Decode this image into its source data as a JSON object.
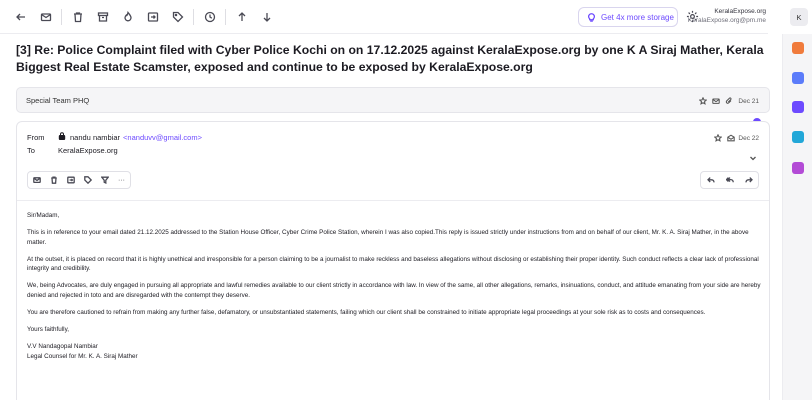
{
  "account": {
    "name": "KeralaExpose.org",
    "email": "KeralaExpose.org@pm.me",
    "avatar_initial": "K"
  },
  "toolbar": {
    "icons": [
      "back-icon",
      "mark-unread-icon",
      "trash-icon",
      "archive-icon",
      "spam-icon",
      "move-icon",
      "label-icon",
      "snooze-icon",
      "previous-icon",
      "next-icon"
    ],
    "storage_button": "Get 4x more storage"
  },
  "subject": "[3] Re: Police Complaint filed with Cyber Police Kochi on on 17.12.2025 against KeralaExpose.org by one K A Siraj Mather, Kerala Biggest Real Estate Scamster, exposed and continue to be exposed by KeralaExpose.org",
  "collapsed_message": {
    "sender": "Special Team PHQ",
    "date": "Dec 21"
  },
  "message": {
    "from_label": "From",
    "to_label": "To",
    "sender_name": "nandu nambiar",
    "sender_email": "<nanduvv@gmail.com>",
    "recipient": "KeralaExpose.org",
    "date": "Dec 22",
    "more_label": "···",
    "body": [
      "Sir/Madam,",
      "This is in reference to your email dated 21.12.2025 addressed to the Station House Officer, Cyber Crime Police Station, wherein I was also copied.This reply is issued strictly under instructions from and on behalf of our client, Mr. K. A. Siraj Mather, in the above matter.",
      "At the outset, it is placed on record that it is highly unethical and irresponsible for a person claiming to be a journalist to make reckless and baseless allegations without disclosing or establishing their proper identity. Such conduct reflects a clear lack of professional integrity and credibility.",
      "We, being Advocates, are duly engaged in pursuing all appropriate and lawful remedies available to our client strictly in accordance with law. In view of the same, all other allegations, remarks, insinuations, conduct, and attitude emanating from your side are hereby denied and rejected in toto and are disregarded with the contempt they deserve.",
      "You are therefore cautioned to refrain from making any further false, defamatory, or unsubstantiated statements, failing which our client shall be constrained to initiate appropriate legal proceedings at your sole risk as to costs and consequences.",
      "Yours faithfully,"
    ],
    "signature_name": "V.V Nandagopal Nambiar",
    "signature_title": "Legal Counsel for Mr. K. A. Siraj Mather"
  },
  "rail_apps": [
    {
      "name": "contacts-app-icon",
      "color": "#f07b3c"
    },
    {
      "name": "calendar-app-icon",
      "color": "#5b7cfa"
    },
    {
      "name": "vpn-app-icon",
      "color": "#6d4aff"
    },
    {
      "name": "drive-app-icon",
      "color": "#22a7d8"
    },
    {
      "name": "pass-app-icon",
      "color": "#b34bd6"
    }
  ]
}
